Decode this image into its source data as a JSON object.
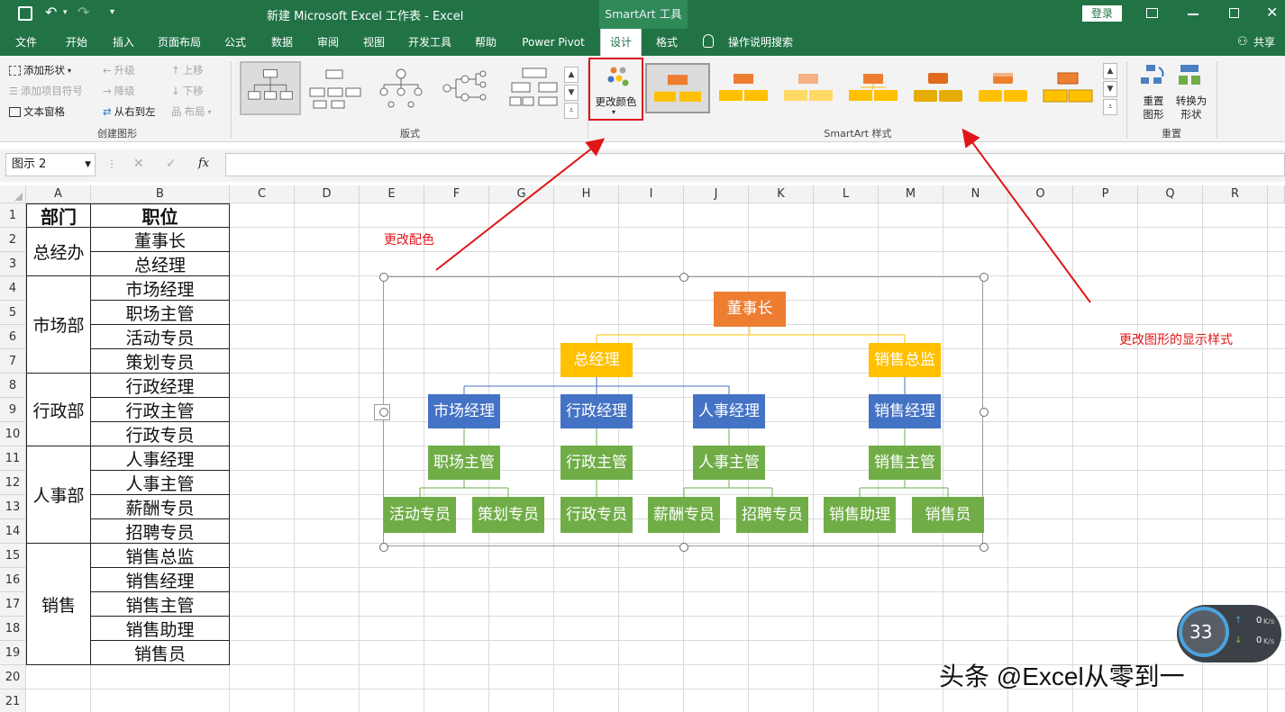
{
  "titlebar": {
    "doc_title": "新建 Microsoft Excel 工作表  -  Excel",
    "context_tab": "SmartArt 工具",
    "login": "登录"
  },
  "tabs": [
    "文件",
    "开始",
    "插入",
    "页面布局",
    "公式",
    "数据",
    "审阅",
    "视图",
    "开发工具",
    "帮助",
    "Power Pivot",
    "设计",
    "格式"
  ],
  "tell_me": "操作说明搜索",
  "share": "共享",
  "ribbon": {
    "create": {
      "add_shape": "添加形状",
      "add_bullet": "添加项目符号",
      "text_pane": "文本窗格",
      "promote": "升级",
      "demote": "降级",
      "rtl": "从右到左",
      "move_up": "上移",
      "move_down": "下移",
      "layout": "布局",
      "label": "创建图形"
    },
    "layouts_label": "版式",
    "change_colors": "更改颜色",
    "styles_label": "SmartArt 样式",
    "reset": {
      "reset_graphic_l1": "重置",
      "reset_graphic_l2": "图形",
      "convert_l1": "转换为",
      "convert_l2": "形状",
      "label": "重置"
    }
  },
  "formula_bar": {
    "name_box": "图示 2",
    "fx": "fx"
  },
  "columns": [
    "A",
    "B",
    "C",
    "D",
    "E",
    "F",
    "G",
    "H",
    "I",
    "J",
    "K",
    "L",
    "M",
    "N",
    "O",
    "P",
    "Q",
    "R"
  ],
  "rows": [
    "1",
    "2",
    "3",
    "4",
    "5",
    "6",
    "7",
    "8",
    "9",
    "10",
    "11",
    "12",
    "13",
    "14",
    "15",
    "16",
    "17",
    "18",
    "19",
    "20",
    "21"
  ],
  "table": {
    "header": [
      "部门",
      "职位"
    ],
    "departments": [
      "总经办",
      "市场部",
      "行政部",
      "人事部",
      "销售"
    ],
    "positions": [
      "董事长",
      "总经理",
      "市场经理",
      "职场主管",
      "活动专员",
      "策划专员",
      "行政经理",
      "行政主管",
      "行政专员",
      "人事经理",
      "人事主管",
      "薪酬专员",
      "招聘专员",
      "销售总监",
      "销售经理",
      "销售主管",
      "销售助理",
      "销售员"
    ]
  },
  "org": {
    "top": "董事长",
    "level2": [
      "总经理",
      "销售总监"
    ],
    "managers": [
      "市场经理",
      "行政经理",
      "人事经理",
      "销售经理"
    ],
    "supervisors": [
      "职场主管",
      "行政主管",
      "人事主管",
      "销售主管"
    ],
    "staff": [
      "活动专员",
      "策划专员",
      "行政专员",
      "薪酬专员",
      "招聘专员",
      "销售助理",
      "销售员"
    ],
    "colors": {
      "orange": "#ed7d31",
      "gold": "#ffc000",
      "blue": "#4472c4",
      "green": "#70ad47"
    }
  },
  "annotations": {
    "colors": "更改配色",
    "styles": "更改图形的显示样式"
  },
  "watermark": "头条 @Excel从零到一",
  "net_widget": {
    "percent": "33",
    "up": "0",
    "down": "0",
    "unit": "K/s"
  }
}
